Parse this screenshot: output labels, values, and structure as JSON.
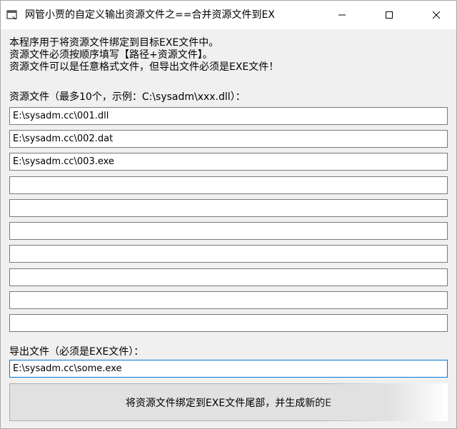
{
  "window": {
    "title": "网管小贾的自定义输出资源文件之==合并资源文件到EX",
    "icon": "app-window-icon"
  },
  "description": {
    "line1": "本程序用于将资源文件绑定到目标EXE文件中。",
    "line2": "资源文件必须按顺序填写【路径+资源文件】。",
    "line3": "资源文件可以是任意格式文件，但导出文件必须是EXE文件！"
  },
  "resources": {
    "label": "资源文件（最多10个，示例：C:\\sysadm\\xxx.dll）：",
    "fields": [
      "E:\\sysadm.cc\\001.dll",
      "E:\\sysadm.cc\\002.dat",
      "E:\\sysadm.cc\\003.exe",
      "",
      "",
      "",
      "",
      "",
      "",
      ""
    ]
  },
  "output": {
    "label": "导出文件（必须是EXE文件）：",
    "value": "E:\\sysadm.cc\\some.exe"
  },
  "action": {
    "bind_label": "将资源文件绑定到EXE文件尾部，并生成新的E"
  },
  "colors": {
    "focus_border": "#0078d7",
    "button_face": "#e1e1e1"
  }
}
